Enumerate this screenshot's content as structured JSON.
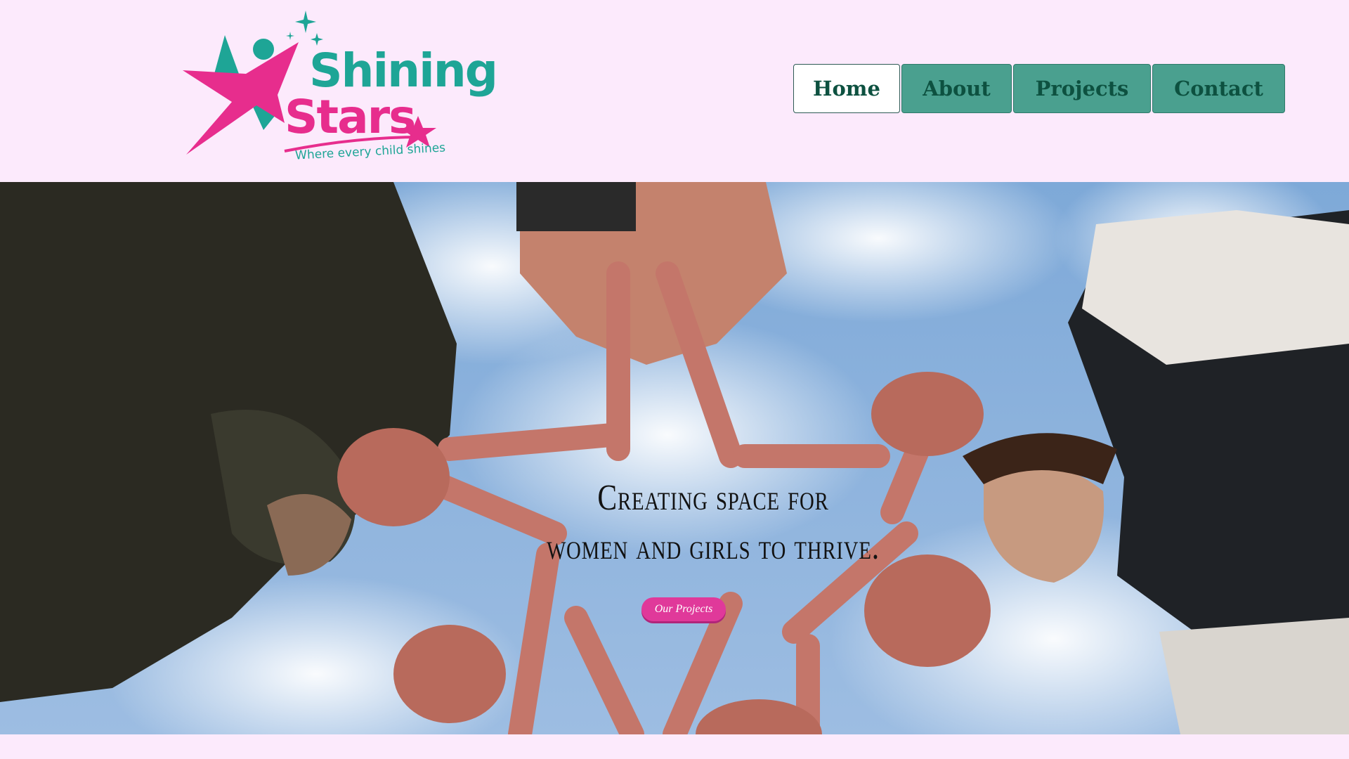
{
  "brand": {
    "name_line1": "Shining",
    "name_line2": "Stars",
    "tagline": "Where every child shines",
    "colors": {
      "teal": "#1ea596",
      "pink": "#e72d8d",
      "page_bg": "#fceafc"
    }
  },
  "nav": {
    "items": [
      {
        "label": "Home",
        "active": true
      },
      {
        "label": "About",
        "active": false
      },
      {
        "label": "Projects",
        "active": false
      },
      {
        "label": "Contact",
        "active": false
      }
    ],
    "colors": {
      "button_bg": "#4aa08f",
      "text": "#0d5140"
    }
  },
  "hero": {
    "title_line1": "Creating space for",
    "title_line2": "women and girls to thrive.",
    "cta_label": "Our Projects",
    "cta_color": "#e0399a",
    "image_description_icon": "hands-forming-star-photo"
  }
}
